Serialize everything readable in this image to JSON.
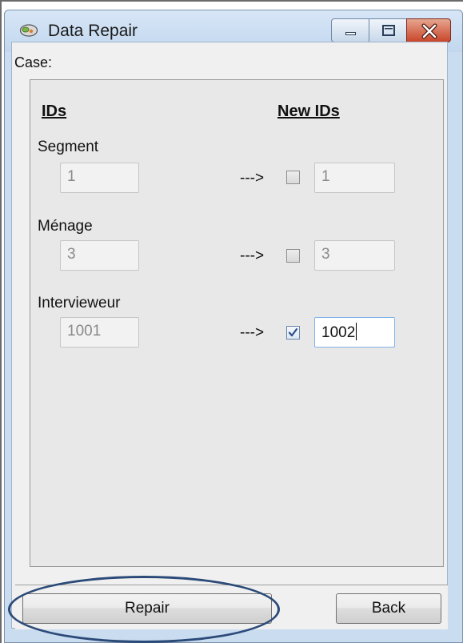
{
  "window": {
    "title": "Data Repair",
    "controls": {
      "minimize": "minimize-icon",
      "maximize": "maximize-icon",
      "close": "close-icon"
    }
  },
  "form": {
    "case_label": "Case:",
    "ids_header": "IDs",
    "new_ids_header": "New IDs",
    "arrow": "--->",
    "fields": [
      {
        "label": "Segment",
        "value": "1",
        "new_checked": false,
        "new_value": "1"
      },
      {
        "label": "Ménage",
        "value": "3",
        "new_checked": false,
        "new_value": "3"
      },
      {
        "label": "Intervieweur",
        "value": "1001",
        "new_checked": true,
        "new_value": "1002"
      }
    ]
  },
  "buttons": {
    "repair": "Repair",
    "back": "Back"
  },
  "colors": {
    "title_bar": "#c9dcf0",
    "close_button": "#c9452a",
    "highlight": "#2b4a78",
    "active_input_border": "#7eb4ea"
  }
}
